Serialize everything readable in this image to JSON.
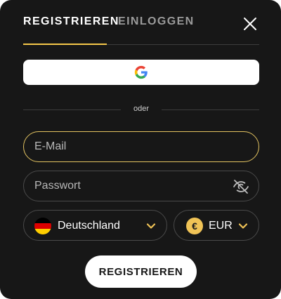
{
  "tabs": {
    "register_label": "REGISTRIEREN",
    "login_label": "EINLOGGEN"
  },
  "close": {
    "icon": "close-icon"
  },
  "google": {
    "icon": "google-icon"
  },
  "divider": {
    "label": "oder"
  },
  "form": {
    "email_placeholder": "E-Mail",
    "email_value": "",
    "password_placeholder": "Passwort",
    "password_value": "",
    "password_toggle_icon": "eye-off-icon"
  },
  "country": {
    "selected": "Deutschland",
    "flag": "germany-flag-icon"
  },
  "currency": {
    "selected": "EUR",
    "symbol": "€"
  },
  "submit_label": "REGISTRIEREN",
  "colors": {
    "background": "#171717",
    "accent": "#f5c84a",
    "text": "#ffffff",
    "muted": "#9a9a9a"
  }
}
